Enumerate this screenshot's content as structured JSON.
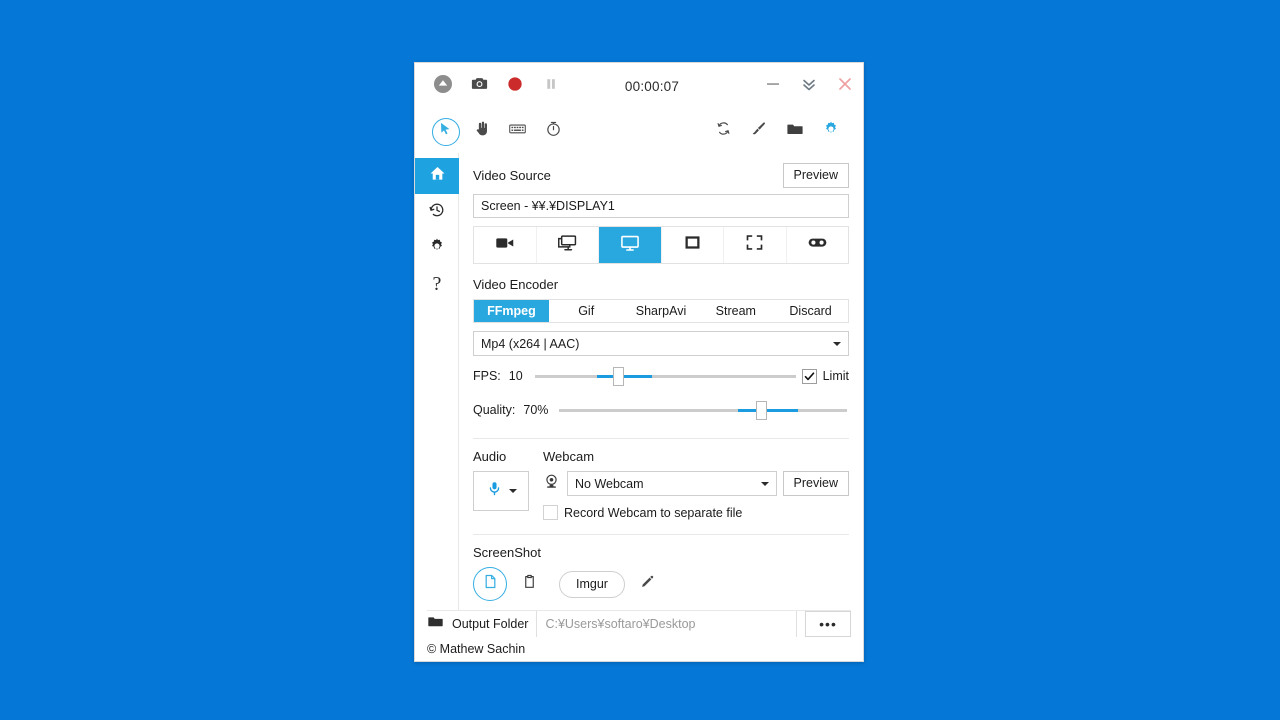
{
  "desktop": {
    "background_color": "#0577d6"
  },
  "window": {
    "accent_color": "#29a8e0",
    "titlebar": {
      "tray_icon": "up-arrow-circle-icon",
      "screenshot_icon": "camera-icon",
      "record_icon": "record-dot-icon",
      "pause_icon": "pause-icon",
      "timer": "00:00:07",
      "minimize": "minimize-icon",
      "collapse": "double-chevron-down-icon",
      "close": "close-x-icon"
    },
    "toolbar": {
      "left": [
        {
          "name": "cursor-icon",
          "selected": true
        },
        {
          "name": "click-hand-icon",
          "selected": false
        },
        {
          "name": "keyboard-icon",
          "selected": false
        },
        {
          "name": "stopwatch-icon",
          "selected": false
        }
      ],
      "right": [
        {
          "name": "refresh-icon",
          "selected": false
        },
        {
          "name": "brush-icon",
          "selected": false
        },
        {
          "name": "folder-icon",
          "selected": false
        },
        {
          "name": "gear-icon",
          "selected": true
        }
      ]
    },
    "sidebar": {
      "items": [
        {
          "label": "Home",
          "icon": "home-icon",
          "selected": true
        },
        {
          "label": "History",
          "icon": "history-icon",
          "selected": false
        },
        {
          "label": "Settings",
          "icon": "gear-icon",
          "selected": false
        },
        {
          "label": "Help",
          "icon": "question-mark-icon",
          "selected": false
        }
      ]
    },
    "video_source": {
      "title": "Video Source",
      "preview_label": "Preview",
      "value": "Screen  -  ¥¥.¥DISPLAY1",
      "modes": [
        {
          "name": "video-camera-icon",
          "selected": false
        },
        {
          "name": "multi-screen-icon",
          "selected": false
        },
        {
          "name": "screen-icon",
          "selected": true
        },
        {
          "name": "window-icon",
          "selected": false
        },
        {
          "name": "region-crop-icon",
          "selected": false
        },
        {
          "name": "game-controller-icon",
          "selected": false
        }
      ]
    },
    "video_encoder": {
      "title": "Video Encoder",
      "tabs": [
        {
          "label": "FFmpeg",
          "selected": true
        },
        {
          "label": "Gif",
          "selected": false
        },
        {
          "label": "SharpAvi",
          "selected": false
        },
        {
          "label": "Stream",
          "selected": false
        },
        {
          "label": "Discard",
          "selected": false
        }
      ],
      "format": "Mp4 (x264 | AAC)",
      "fps": {
        "label": "FPS:",
        "value": "10",
        "percent": 30
      },
      "fps_limit": {
        "label": "Limit",
        "checked": true
      },
      "quality": {
        "label": "Quality:",
        "value": "70%",
        "percent": 70
      }
    },
    "audio": {
      "title": "Audio",
      "device_icon": "microphone-icon"
    },
    "webcam": {
      "title": "Webcam",
      "icon": "webcam-icon",
      "value": "No Webcam",
      "preview_label": "Preview",
      "separate_file": {
        "label": "Record Webcam to separate file",
        "checked": false
      }
    },
    "screenshot": {
      "title": "ScreenShot",
      "targets": [
        {
          "name": "save-file-icon",
          "selected": true
        },
        {
          "name": "clipboard-icon",
          "selected": false
        }
      ],
      "imgur_label": "Imgur",
      "edit_icon": "pencil-icon"
    },
    "footer": {
      "folder_icon": "folder-icon",
      "output_label": "Output Folder",
      "path": "C:¥Users¥softaro¥Desktop",
      "more_label": "•••",
      "copyright": "© Mathew Sachin"
    }
  }
}
